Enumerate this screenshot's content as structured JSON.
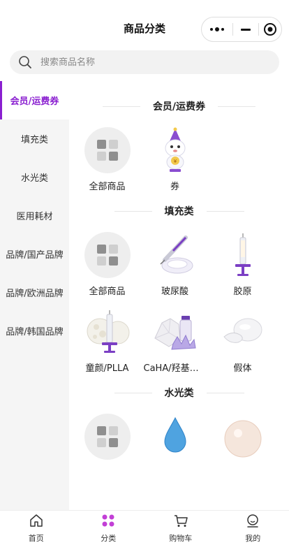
{
  "header": {
    "title": "商品分类"
  },
  "search": {
    "placeholder": "搜索商品名称"
  },
  "sidebar": {
    "items": [
      {
        "label": "会员/运费券",
        "active": true
      },
      {
        "label": "填充类"
      },
      {
        "label": "水光类"
      },
      {
        "label": "医用耗材"
      },
      {
        "label": "品牌/国产品牌"
      },
      {
        "label": "品牌/欧洲品牌"
      },
      {
        "label": "品牌/韩国品牌"
      }
    ]
  },
  "sections": [
    {
      "title": "会员/运费券",
      "items": [
        {
          "label": "全部商品",
          "icon": "grid-icon"
        },
        {
          "label": "券",
          "icon": "coupon-mascot"
        }
      ]
    },
    {
      "title": "填充类",
      "items": [
        {
          "label": "全部商品",
          "icon": "grid-icon"
        },
        {
          "label": "玻尿酸",
          "icon": "syringe-gel"
        },
        {
          "label": "胶原",
          "icon": "syringe"
        },
        {
          "label": "童颜/PLLA",
          "icon": "syringe-sphere"
        },
        {
          "label": "CaHA/羟基磷灰石",
          "icon": "crystal-vial"
        },
        {
          "label": "假体",
          "icon": "implant"
        }
      ]
    },
    {
      "title": "水光类",
      "items": [
        {
          "label": "",
          "icon": "grid-icon"
        },
        {
          "label": "",
          "icon": "water-drop"
        },
        {
          "label": "",
          "icon": "pearl"
        }
      ]
    }
  ],
  "tabbar": {
    "items": [
      {
        "label": "首页"
      },
      {
        "label": "分类",
        "active": true
      },
      {
        "label": "购物车"
      },
      {
        "label": "我的"
      }
    ]
  },
  "colors": {
    "accent": "#8a1fd0",
    "sidebar_bg": "#f5f5f5",
    "search_bg": "#f2f2f2"
  }
}
